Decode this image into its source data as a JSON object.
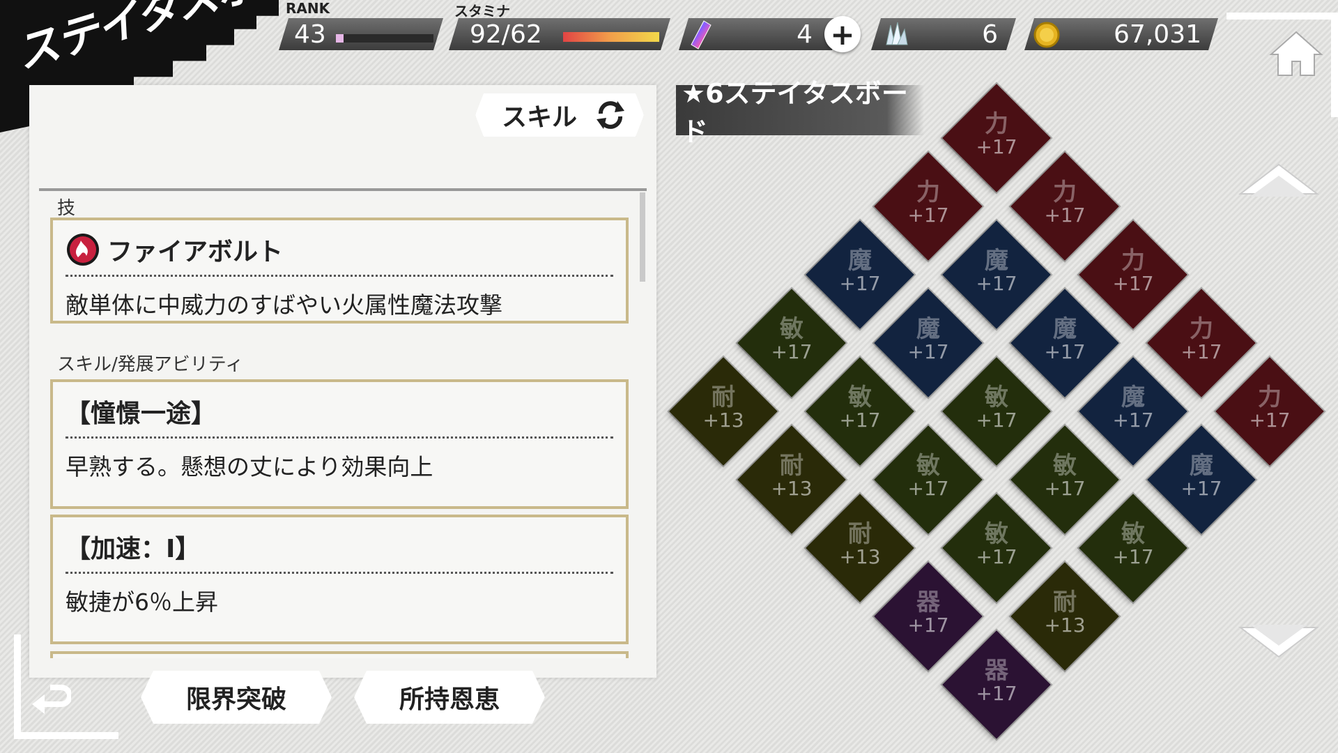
{
  "screen_title": "ステイタスボード",
  "hud": {
    "rank_label": "RANK",
    "rank_value": "43",
    "rank_progress": 0.08,
    "stamina_label": "スタミナ",
    "stamina_value": "92/62",
    "stamina_progress": 1.0,
    "gem_count": "4",
    "crystal_count": "6",
    "gold_count": "67,031"
  },
  "skill_tab_label": "スキル",
  "sections": {
    "technique_label": "技",
    "ability_label": "スキル/発展アビリティ"
  },
  "technique": {
    "name": "ファイアボルト",
    "description": "敵単体に中威力のすばやい火属性魔法攻撃"
  },
  "abilities": [
    {
      "name": "【憧憬一途】",
      "description": "早熟する。懸想の丈により効果向上"
    },
    {
      "name": "【加速：Ⅰ】",
      "description": "敏捷が6％上昇"
    }
  ],
  "buttons": {
    "limit_break": "限界突破",
    "owned_blessings": "所持恩恵"
  },
  "board_title": "★6ステイタスボード",
  "colors": {
    "power": "#4a0f14",
    "magic": "#12233f",
    "agility": "#232e0c",
    "endurance": "#2a2a08",
    "dexterity": "#2b1233"
  },
  "board_tiles": [
    {
      "stat": "力",
      "value": "+17",
      "type": "power"
    },
    {
      "stat": "力",
      "value": "+17",
      "type": "power"
    },
    {
      "stat": "力",
      "value": "+17",
      "type": "power"
    },
    {
      "stat": "魔",
      "value": "+17",
      "type": "magic"
    },
    {
      "stat": "魔",
      "value": "+17",
      "type": "magic"
    },
    {
      "stat": "力",
      "value": "+17",
      "type": "power"
    },
    {
      "stat": "敏",
      "value": "+17",
      "type": "agility"
    },
    {
      "stat": "魔",
      "value": "+17",
      "type": "magic"
    },
    {
      "stat": "魔",
      "value": "+17",
      "type": "magic"
    },
    {
      "stat": "力",
      "value": "+17",
      "type": "power"
    },
    {
      "stat": "耐",
      "value": "+13",
      "type": "endurance"
    },
    {
      "stat": "敏",
      "value": "+17",
      "type": "agility"
    },
    {
      "stat": "敏",
      "value": "+17",
      "type": "agility"
    },
    {
      "stat": "魔",
      "value": "+17",
      "type": "magic"
    },
    {
      "stat": "力",
      "value": "+17",
      "type": "power"
    },
    {
      "stat": "耐",
      "value": "+13",
      "type": "endurance"
    },
    {
      "stat": "敏",
      "value": "+17",
      "type": "agility"
    },
    {
      "stat": "敏",
      "value": "+17",
      "type": "agility"
    },
    {
      "stat": "魔",
      "value": "+17",
      "type": "magic"
    },
    {
      "stat": "耐",
      "value": "+13",
      "type": "endurance"
    },
    {
      "stat": "敏",
      "value": "+17",
      "type": "agility"
    },
    {
      "stat": "敏",
      "value": "+17",
      "type": "agility"
    },
    {
      "stat": "器",
      "value": "+17",
      "type": "dexterity"
    },
    {
      "stat": "耐",
      "value": "+13",
      "type": "endurance"
    },
    {
      "stat": "器",
      "value": "+17",
      "type": "dexterity"
    }
  ]
}
